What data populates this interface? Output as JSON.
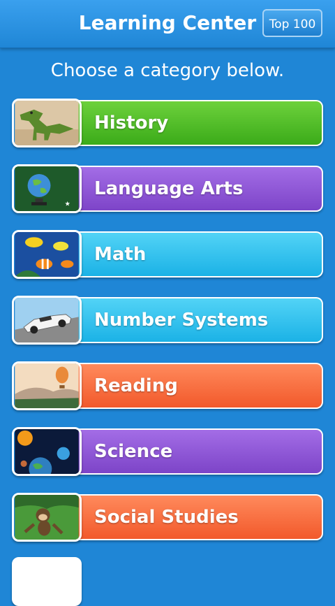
{
  "header": {
    "title": "Learning Center",
    "top_button": "Top 100"
  },
  "subtitle": "Choose a category below.",
  "categories": [
    {
      "label": "History"
    },
    {
      "label": "Language Arts"
    },
    {
      "label": "Math"
    },
    {
      "label": "Number Systems"
    },
    {
      "label": "Reading"
    },
    {
      "label": "Science"
    },
    {
      "label": "Social Studies"
    }
  ],
  "colors": {
    "background": "#1f86d6",
    "green": "#4cbc26",
    "purple": "#8f56d6",
    "cyan": "#2ec0ee",
    "orange": "#f76a3a"
  }
}
